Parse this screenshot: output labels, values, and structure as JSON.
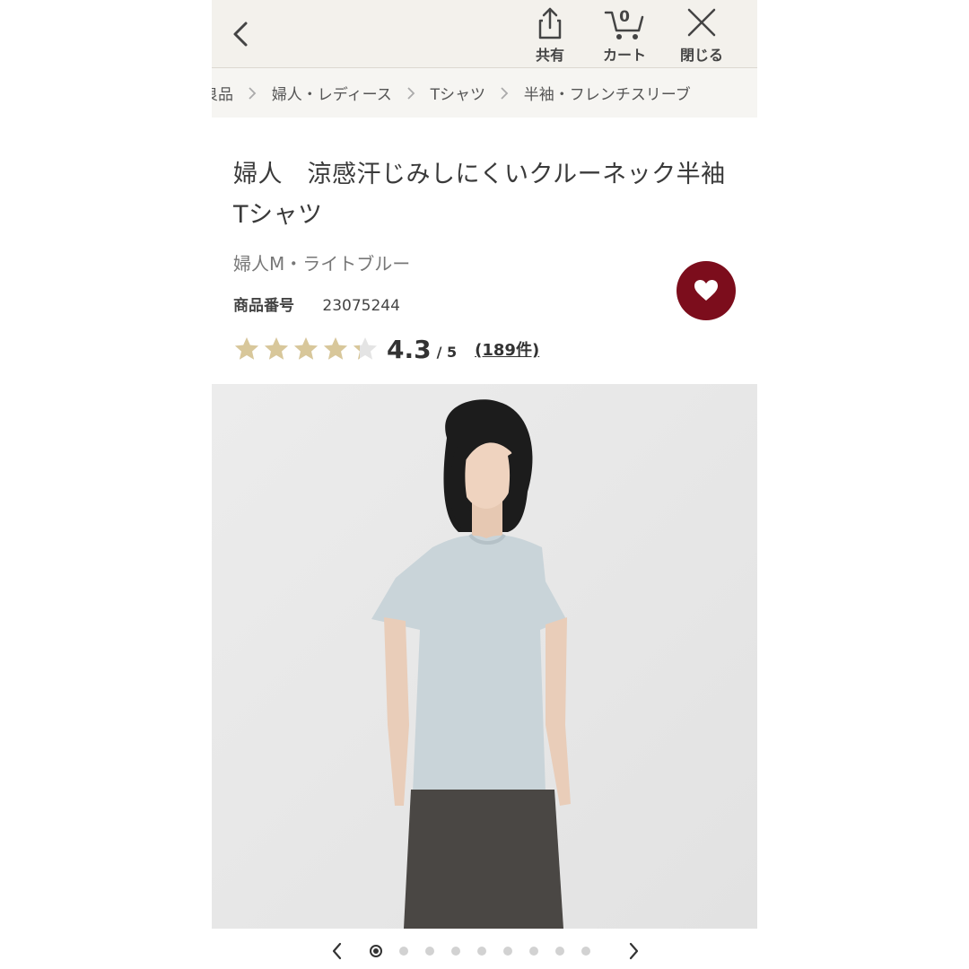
{
  "header": {
    "share_label": "共有",
    "cart_label": "カート",
    "cart_count": "0",
    "close_label": "閉じる"
  },
  "breadcrumb": [
    "良品",
    "婦人・レディース",
    "Tシャツ",
    "半袖・フレンチスリーブ"
  ],
  "product": {
    "title": "婦人　涼感汗じみしにくいクルーネック半袖Tシャツ",
    "variant": "婦人M・ライトブルー",
    "code_label": "商品番号",
    "code": "23075244",
    "rating_value": "4.3",
    "rating_outof": "/ 5",
    "rating_fraction": 0.86,
    "reviews": "(189件)"
  },
  "gallery": {
    "slide_count": 9,
    "current_slide": 1
  },
  "colors": {
    "favorite": "#7c0d1c",
    "star": "#d8c79a"
  }
}
